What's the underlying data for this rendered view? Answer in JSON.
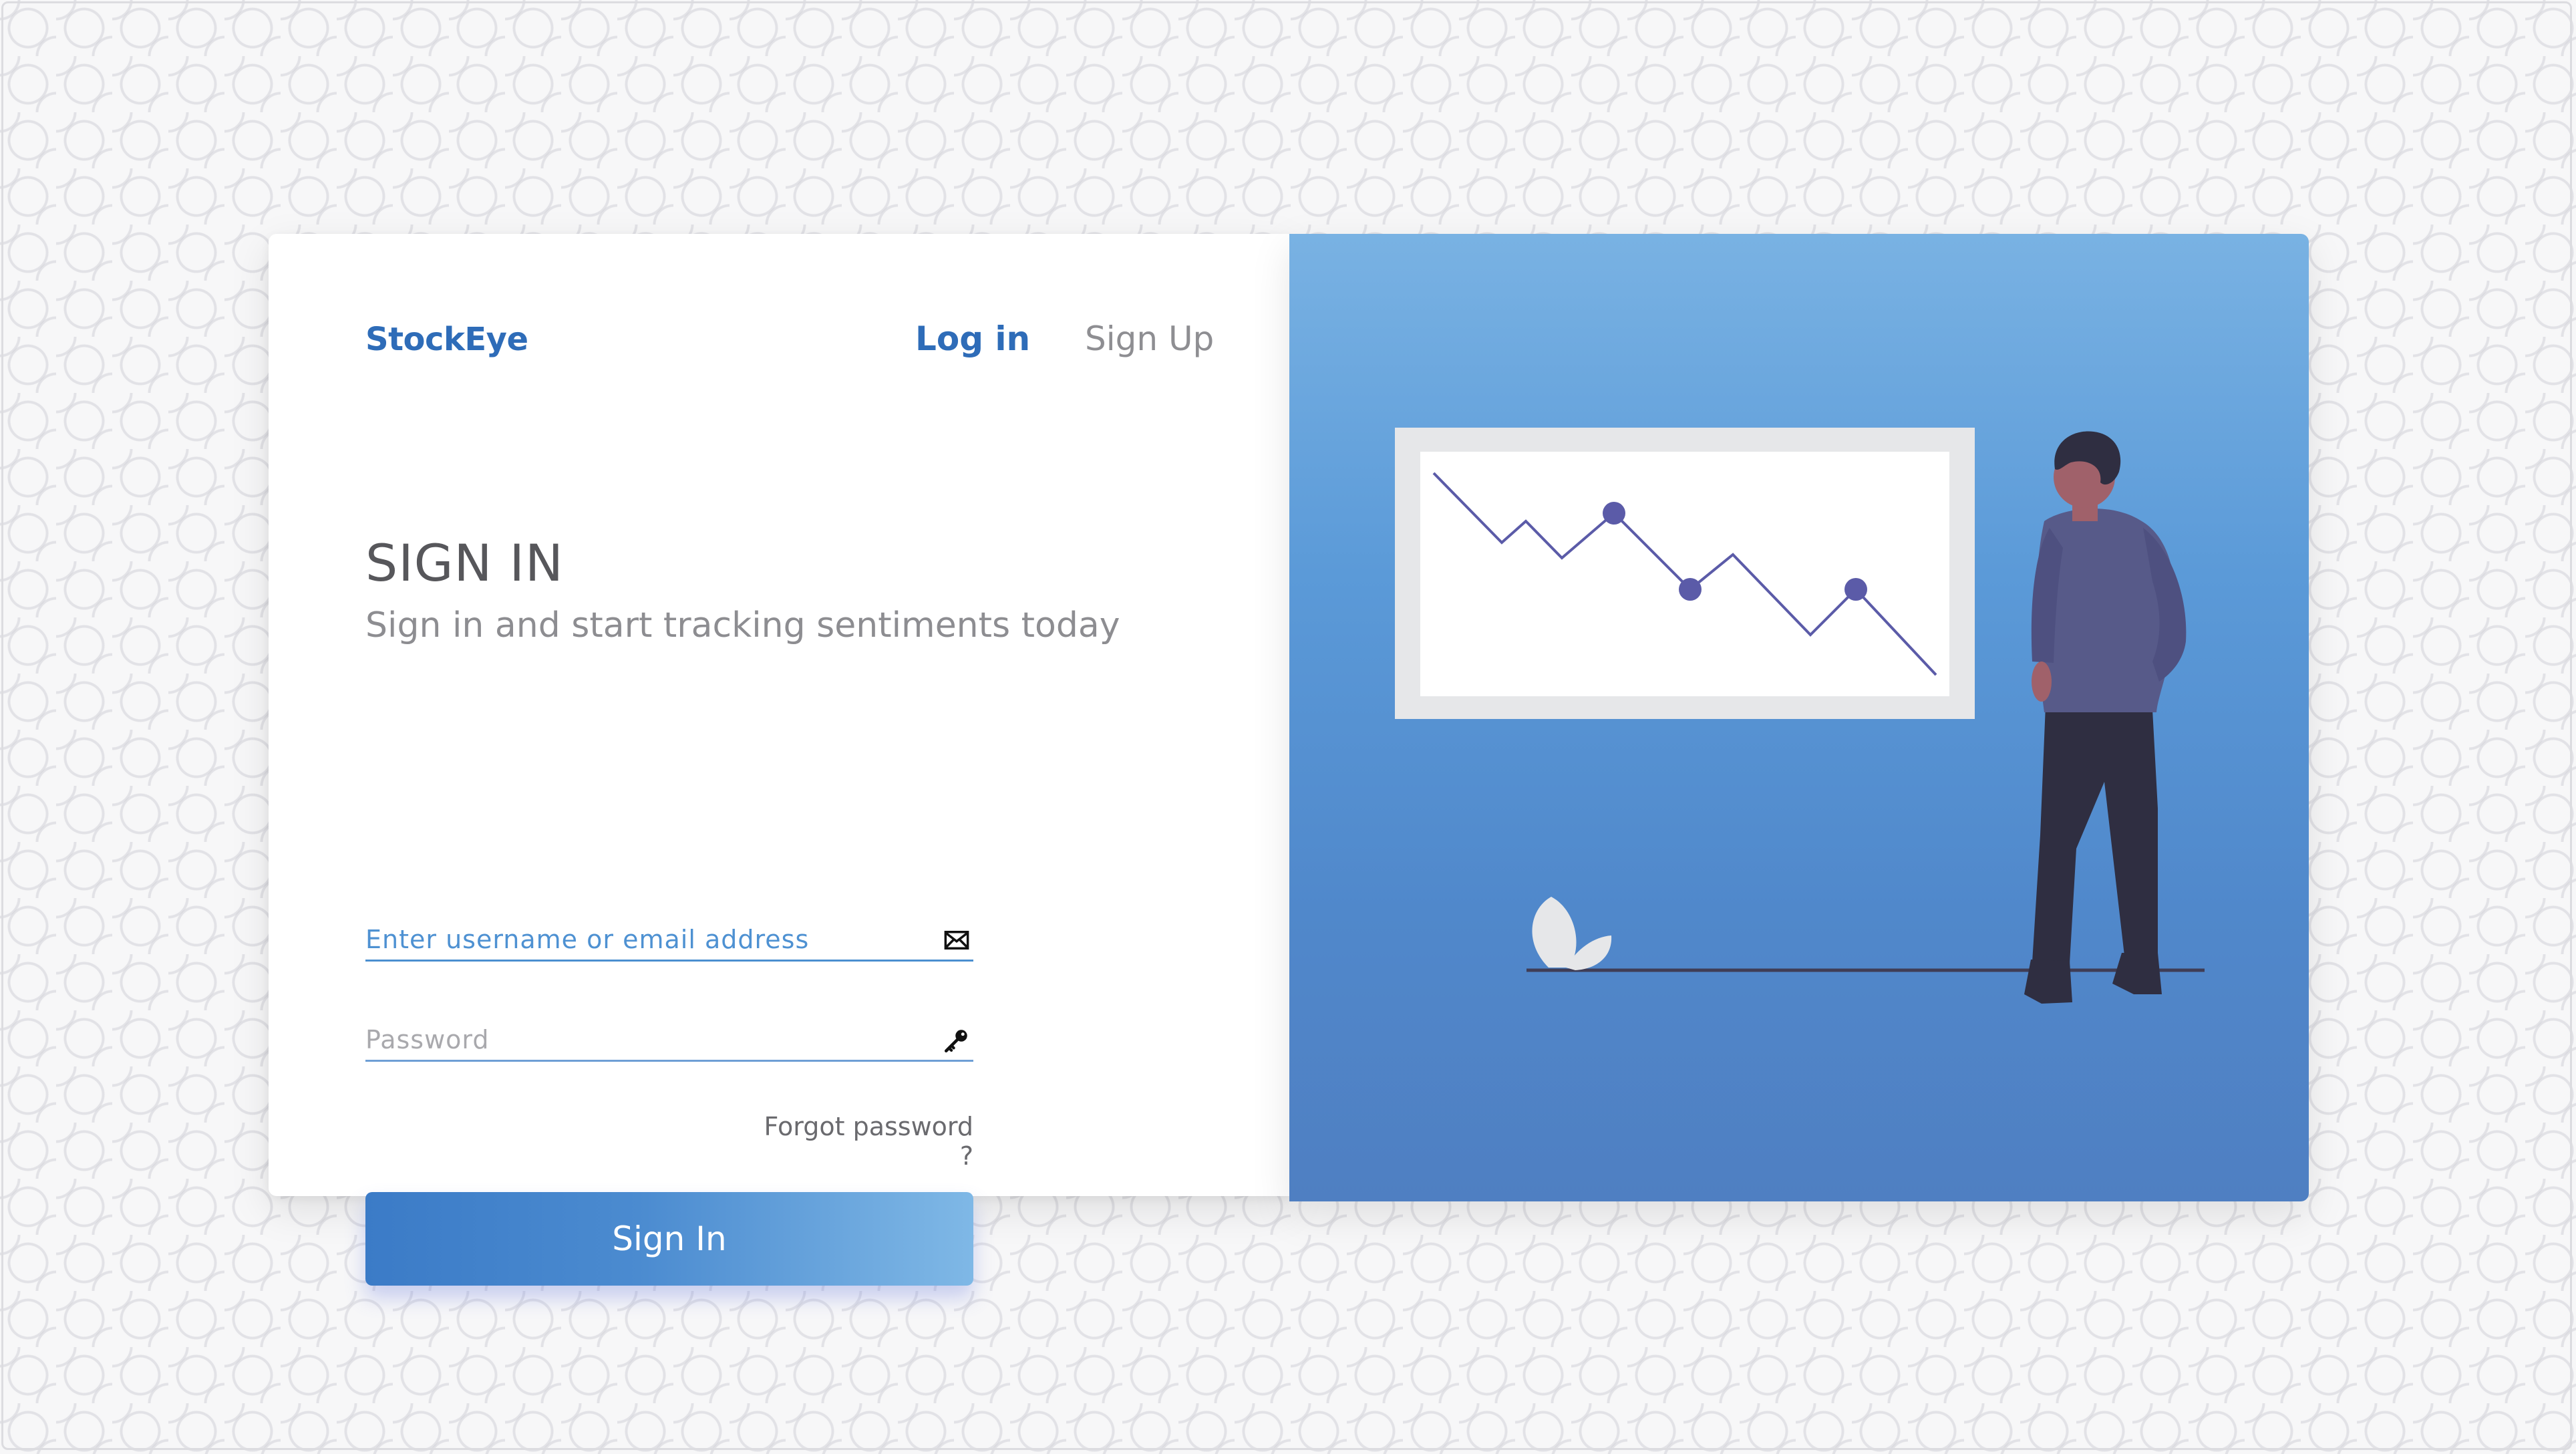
{
  "brand": {
    "name": "StockEye",
    "color": "#2e6cb8"
  },
  "nav": {
    "login": "Log in",
    "signup": "Sign Up"
  },
  "heading": {
    "title": "SIGN IN",
    "subtitle": "Sign in and start tracking sentiments today"
  },
  "form": {
    "username_placeholder": "Enter username or email address",
    "username_icon": "envelope-icon",
    "password_placeholder": "Password",
    "password_icon": "key-icon",
    "forgot": "Forgot password ?",
    "submit": "Sign In"
  },
  "illustration": {
    "subject": "person-looking-at-chart",
    "chart_trend": "downward"
  },
  "colors": {
    "accent": "#2e6cb8",
    "panel_top": "#79b2e3",
    "panel_bottom": "#4f7fc2",
    "chart_line": "#5b5ba8"
  }
}
